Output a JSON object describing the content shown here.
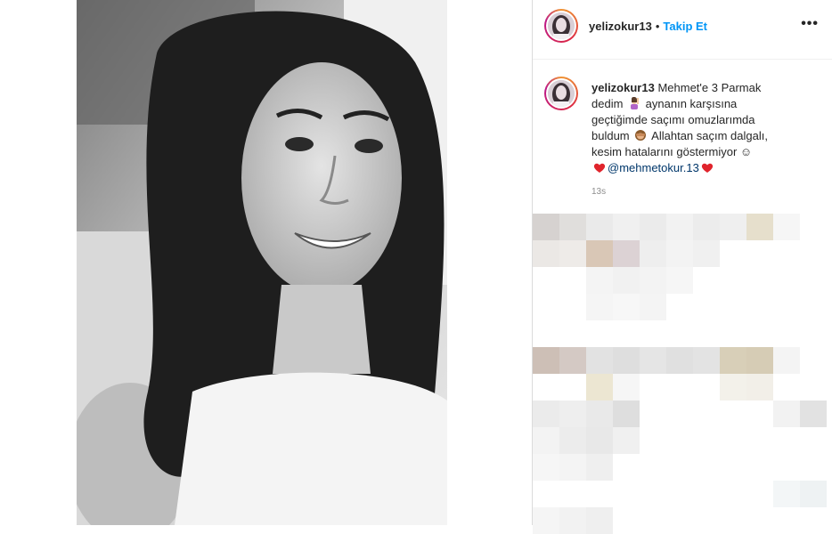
{
  "post": {
    "username": "yelizokur13",
    "separator": "•",
    "follow_label": "Takip Et",
    "more_icon": "more-options-icon",
    "caption": {
      "username": "yelizokur13",
      "line1": "Mehmet'e 3 Parmak",
      "line2a": "dedim",
      "line2b": "aynanın karşısına",
      "line3": "geçtiğimde saçımı omuzlarımda",
      "line4a": "buldum",
      "line4b": "Allahtan saçım dalgalı,",
      "line5": "kesim hatalarını göstermiyor ☺",
      "mention": "@mehmetokur.13"
    },
    "timestamp": "13s"
  },
  "colors": {
    "follow": "#0095f6",
    "mention": "#00376b",
    "text": "#262626"
  }
}
